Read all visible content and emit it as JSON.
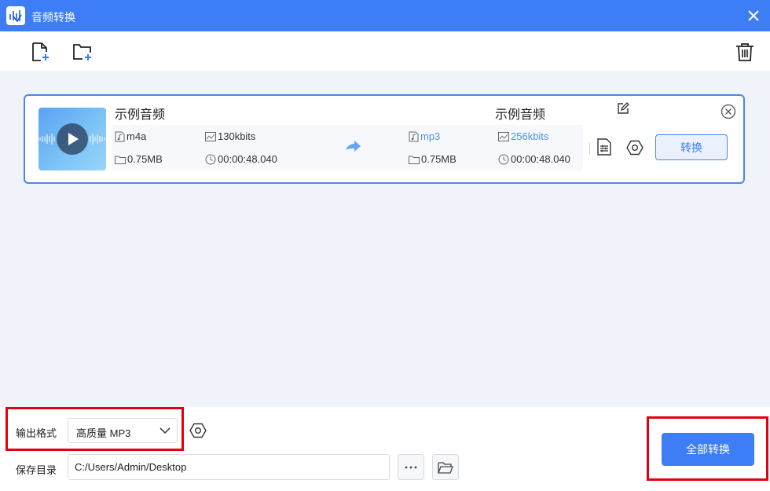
{
  "window": {
    "title": "音频转换"
  },
  "file_item": {
    "source": {
      "name": "示例音频",
      "format": "m4a",
      "bitrate": "130kbits",
      "size": "0.75MB",
      "duration": "00:00:48.040"
    },
    "target": {
      "name": "示例音频",
      "format": "mp3",
      "bitrate": "256kbits",
      "size": "0.75MB",
      "duration": "00:00:48.040"
    },
    "convert_label": "转换"
  },
  "bottom": {
    "format_label": "输出格式",
    "format_value": "高质量 MP3",
    "save_label": "保存目录",
    "save_path": "C:/Users/Admin/Desktop",
    "convert_all_label": "全部转换"
  },
  "colors": {
    "accent": "#3d7df5",
    "highlight": "#e0000f",
    "workspace_bg": "#f1f3fa"
  }
}
